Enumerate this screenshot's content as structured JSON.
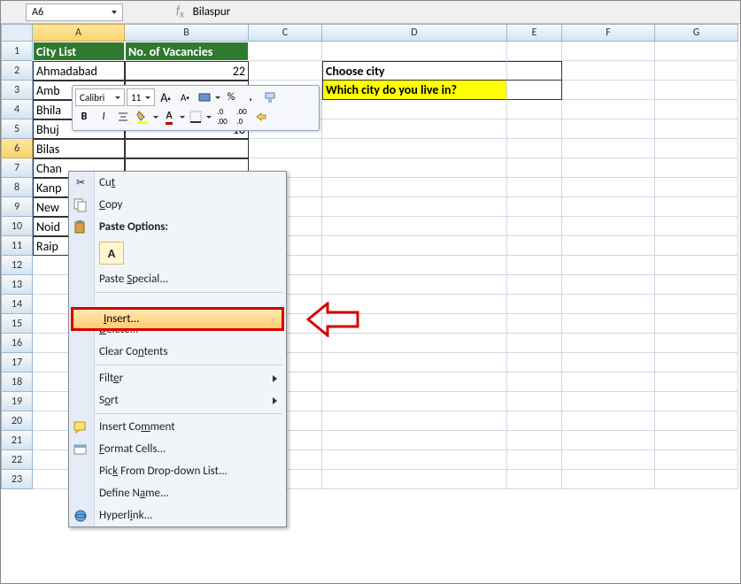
{
  "name_box": "A6",
  "formula_value": "Bilaspur",
  "cols": [
    "A",
    "B",
    "C",
    "D",
    "E",
    "F",
    "G"
  ],
  "selected_col": "A",
  "selected_row": 6,
  "rows": [
    1,
    2,
    3,
    4,
    5,
    6,
    7,
    8,
    9,
    10,
    11,
    12,
    13,
    14,
    15,
    16,
    17,
    18,
    19,
    20,
    21,
    22,
    23
  ],
  "headers": {
    "a1": "City List",
    "b1": "No. of Vacancies"
  },
  "table": [
    {
      "city": "Ahmadabad",
      "vac": "22"
    },
    {
      "city": "Amb",
      "vac": ""
    },
    {
      "city": "Bhila",
      "vac": ""
    },
    {
      "city": "Bhuj",
      "vac": "10"
    },
    {
      "city": "Bilas",
      "vac": ""
    },
    {
      "city": "Chan",
      "vac": ""
    },
    {
      "city": "Kanp",
      "vac": ""
    },
    {
      "city": "New",
      "vac": ""
    },
    {
      "city": "Noid",
      "vac": ""
    },
    {
      "city": "Raip",
      "vac": ""
    }
  ],
  "d2": "Choose city",
  "d3": "Which city do you live in?",
  "mini": {
    "font_name": "Calibri",
    "font_size": "11"
  },
  "context_menu": {
    "cut": "Cut",
    "copy": "Copy",
    "paste_options": "Paste Options:",
    "paste_special": "Paste Special...",
    "insert": "Insert...",
    "delete": "Delete...",
    "clear_contents": "Clear Contents",
    "filter": "Filter",
    "sort": "Sort",
    "insert_comment": "Insert Comment",
    "format_cells": "Format Cells...",
    "pick_list": "Pick From Drop-down List...",
    "define_name": "Define Name...",
    "hyperlink": "Hyperlink..."
  }
}
